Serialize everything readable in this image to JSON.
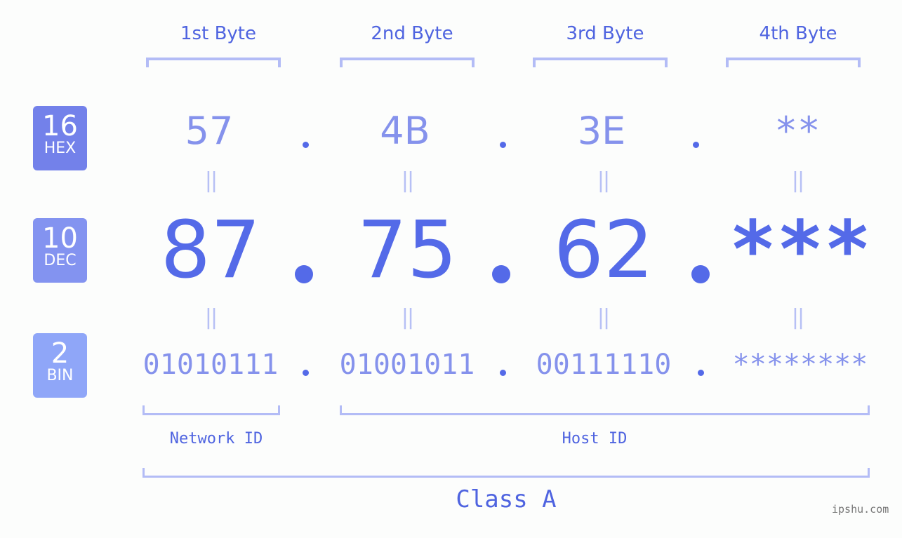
{
  "bytes": [
    {
      "label": "1st Byte",
      "hex": "57",
      "dec": "87",
      "bin": "01010111"
    },
    {
      "label": "2nd Byte",
      "hex": "4B",
      "dec": "75",
      "bin": "01001011"
    },
    {
      "label": "3rd Byte",
      "hex": "3E",
      "dec": "62",
      "bin": "00111110"
    },
    {
      "label": "4th Byte",
      "hex": "**",
      "dec": "***",
      "bin": "********"
    }
  ],
  "badges": {
    "hex": {
      "base": "16",
      "name": "HEX",
      "color": "#7381ea"
    },
    "dec": {
      "base": "10",
      "name": "DEC",
      "color": "#8393f0"
    },
    "bin": {
      "base": "2",
      "name": "BIN",
      "color": "#8fa6f8"
    }
  },
  "equals_symbol": "||",
  "segments": {
    "network": "Network ID",
    "host": "Host ID"
  },
  "ip_class": "Class A",
  "watermark": "ipshu.com",
  "colors": {
    "accent": "#546ae8",
    "label": "#4f64e0",
    "soft": "#8592ec",
    "bracket": "#b3bcf6"
  }
}
